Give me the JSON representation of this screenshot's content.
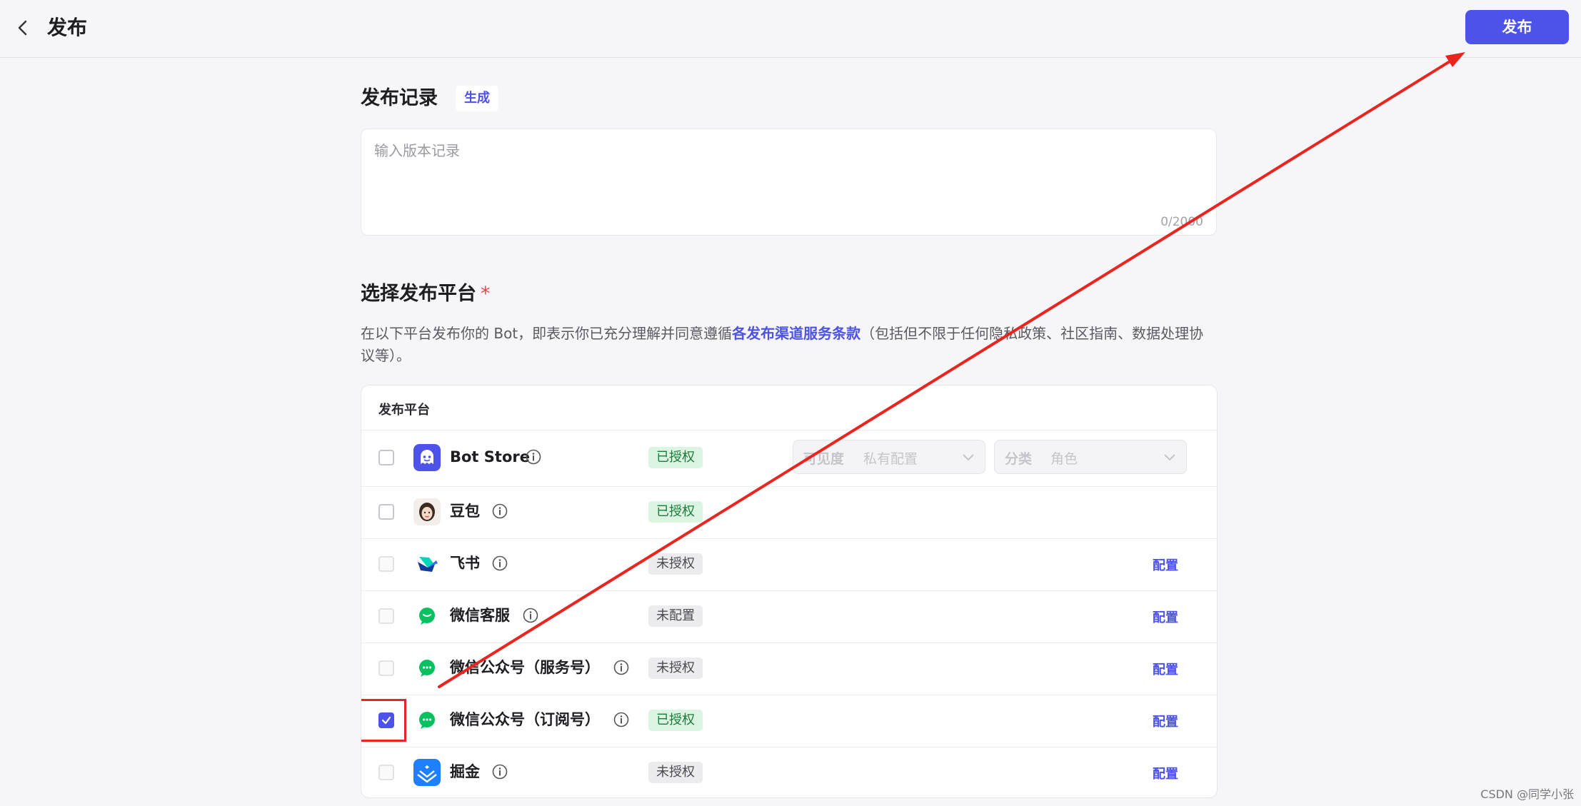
{
  "header": {
    "title": "发布",
    "publish_button": "发布"
  },
  "release_notes": {
    "title": "发布记录",
    "generate_tag": "生成",
    "placeholder": "输入版本记录",
    "char_count": "0/2000"
  },
  "platform_section": {
    "title": "选择发布平台",
    "required_mark": "*",
    "desc_before": "在以下平台发布你的 Bot，即表示你已充分理解并同意遵循",
    "desc_link": "各发布渠道服务条款",
    "desc_after": "（包括但不限于任何隐私政策、社区指南、数据处理协议等）。"
  },
  "table": {
    "header": "发布平台",
    "visibility_label": "可见度",
    "visibility_value": "私有配置",
    "category_label": "分类",
    "category_value": "角色",
    "config_label": "配置",
    "rows": [
      {
        "name": "Bot Store",
        "status": "已授权",
        "status_type": "ok",
        "checked": false,
        "disabled": false,
        "icon": "bot-store-icon"
      },
      {
        "name": "豆包",
        "status": "已授权",
        "status_type": "ok",
        "checked": false,
        "disabled": false,
        "icon": "doubao-icon"
      },
      {
        "name": "飞书",
        "status": "未授权",
        "status_type": "no",
        "checked": false,
        "disabled": true,
        "icon": "feishu-icon"
      },
      {
        "name": "微信客服",
        "status": "未配置",
        "status_type": "no",
        "checked": false,
        "disabled": true,
        "icon": "wechat-icon"
      },
      {
        "name": "微信公众号（服务号）",
        "status": "未授权",
        "status_type": "no",
        "checked": false,
        "disabled": true,
        "icon": "wechat-icon"
      },
      {
        "name": "微信公众号（订阅号）",
        "status": "已授权",
        "status_type": "ok",
        "checked": true,
        "disabled": false,
        "icon": "wechat-icon"
      },
      {
        "name": "掘金",
        "status": "未授权",
        "status_type": "no",
        "checked": false,
        "disabled": true,
        "icon": "juejin-icon"
      }
    ]
  },
  "watermark": "CSDN @同学小张",
  "colors": {
    "accent": "#4d53e8",
    "annotation_red": "#e8251f",
    "authorized_bg": "#dcf4e2",
    "unauthorized_bg": "#ececef"
  }
}
